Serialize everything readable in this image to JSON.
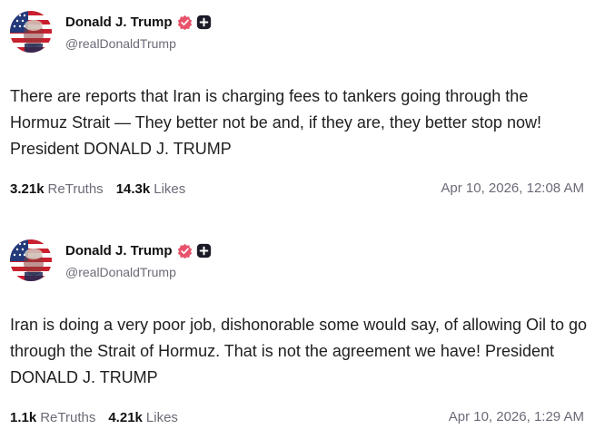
{
  "posts": [
    {
      "author": {
        "display_name": "Donald J. Trump",
        "handle": "@realDonaldTrump",
        "avatar_icon": "flag-portrait-avatar",
        "verified_icon": "verified-badge-icon",
        "verified_color": "#e8526b",
        "extra_badge_icon": "plus-badge-icon"
      },
      "text": "There are reports that Iran is charging fees to tankers going through the Hormuz Strait — They better not be and, if they are, they better stop now! President DONALD J. TRUMP",
      "retruths_count": "3.21k",
      "retruths_label": "ReTruths",
      "likes_count": "14.3k",
      "likes_label": "Likes",
      "timestamp": "Apr 10, 2026, 12:08 AM"
    },
    {
      "author": {
        "display_name": "Donald J. Trump",
        "handle": "@realDonaldTrump",
        "avatar_icon": "flag-portrait-avatar",
        "verified_icon": "verified-badge-icon",
        "verified_color": "#e8526b",
        "extra_badge_icon": "plus-badge-icon"
      },
      "text": "Iran is doing a very poor job, dishonorable some would say, of allowing Oil to go through the Strait of Hormuz. That is not the agreement we have! President DONALD J. TRUMP",
      "retruths_count": "1.1k",
      "retruths_label": "ReTruths",
      "likes_count": "4.21k",
      "likes_label": "Likes",
      "timestamp": "Apr 10, 2026, 1:29 AM"
    }
  ]
}
